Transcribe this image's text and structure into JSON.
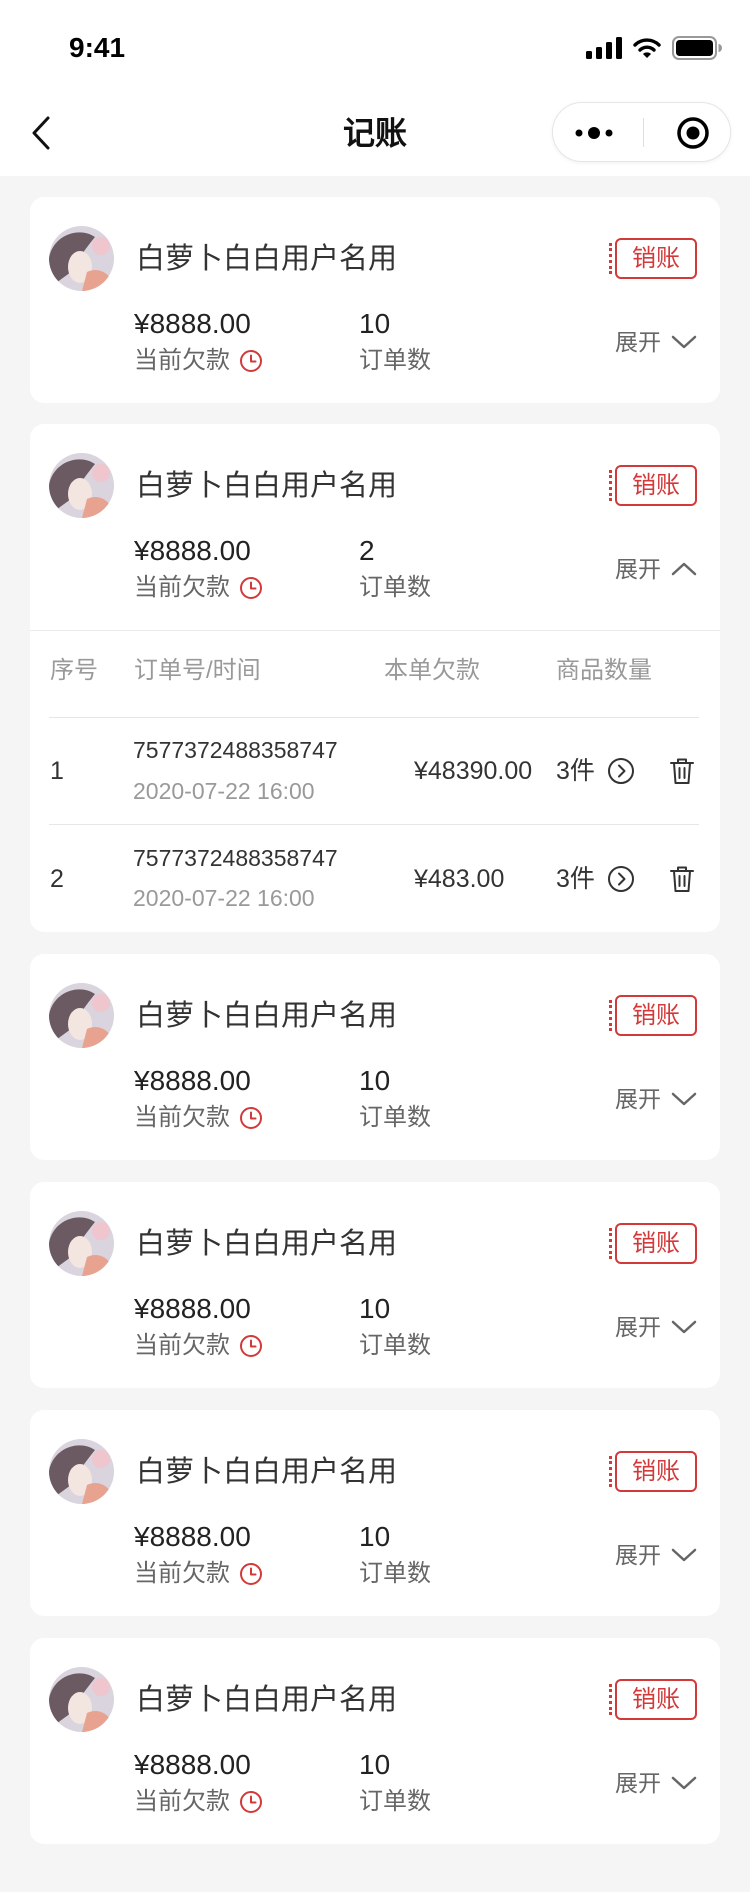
{
  "status_bar": {
    "time": "9:41",
    "icons": [
      "signal-icon",
      "wifi-icon",
      "battery-icon"
    ]
  },
  "nav": {
    "title": "记账",
    "back_icon": "chevron-left-icon",
    "menu_icon": "more-dots-icon",
    "close_icon": "target-circle-icon"
  },
  "theme": {
    "accent": "#d23a3a",
    "page_background": "#f5f5f5",
    "card_background": "#ffffff",
    "text_primary": "#333333",
    "text_secondary": "#666666",
    "text_muted": "#999999"
  },
  "accounts": [
    {
      "name": "白萝卜白白用户名用",
      "action_label": "销账",
      "debt_amount": "¥8888.00",
      "debt_label": "当前欠款",
      "debt_icon": "clock-icon",
      "order_count": "10",
      "order_label": "订单数",
      "toggle_label": "展开",
      "toggle_icon": "chevron-down-icon",
      "expanded": false
    },
    {
      "name": "白萝卜白白用户名用",
      "action_label": "销账",
      "debt_amount": "¥8888.00",
      "debt_label": "当前欠款",
      "debt_icon": "clock-icon",
      "order_count": "2",
      "order_label": "订单数",
      "toggle_label": "展开",
      "toggle_icon": "chevron-up-icon",
      "expanded": true,
      "orders_table": {
        "headers": [
          "序号",
          "订单号/时间",
          "本单欠款",
          "商品数量"
        ],
        "rows": [
          {
            "index": "1",
            "order_no": "7577372488358747",
            "time": "2020-07-22 16:00",
            "amount": "¥48390.00",
            "quantity": "3件",
            "detail_icon": "chevron-right-circle-icon",
            "delete_icon": "trash-icon"
          },
          {
            "index": "2",
            "order_no": "7577372488358747",
            "time": "2020-07-22 16:00",
            "amount": "¥483.00",
            "quantity": "3件",
            "detail_icon": "chevron-right-circle-icon",
            "delete_icon": "trash-icon"
          }
        ]
      }
    },
    {
      "name": "白萝卜白白用户名用",
      "action_label": "销账",
      "debt_amount": "¥8888.00",
      "debt_label": "当前欠款",
      "debt_icon": "clock-icon",
      "order_count": "10",
      "order_label": "订单数",
      "toggle_label": "展开",
      "toggle_icon": "chevron-down-icon",
      "expanded": false
    },
    {
      "name": "白萝卜白白用户名用",
      "action_label": "销账",
      "debt_amount": "¥8888.00",
      "debt_label": "当前欠款",
      "debt_icon": "clock-icon",
      "order_count": "10",
      "order_label": "订单数",
      "toggle_label": "展开",
      "toggle_icon": "chevron-down-icon",
      "expanded": false
    },
    {
      "name": "白萝卜白白用户名用",
      "action_label": "销账",
      "debt_amount": "¥8888.00",
      "debt_label": "当前欠款",
      "debt_icon": "clock-icon",
      "order_count": "10",
      "order_label": "订单数",
      "toggle_label": "展开",
      "toggle_icon": "chevron-down-icon",
      "expanded": false
    },
    {
      "name": "白萝卜白白用户名用",
      "action_label": "销账",
      "debt_amount": "¥8888.00",
      "debt_label": "当前欠款",
      "debt_icon": "clock-icon",
      "order_count": "10",
      "order_label": "订单数",
      "toggle_label": "展开",
      "toggle_icon": "chevron-down-icon",
      "expanded": false
    }
  ]
}
